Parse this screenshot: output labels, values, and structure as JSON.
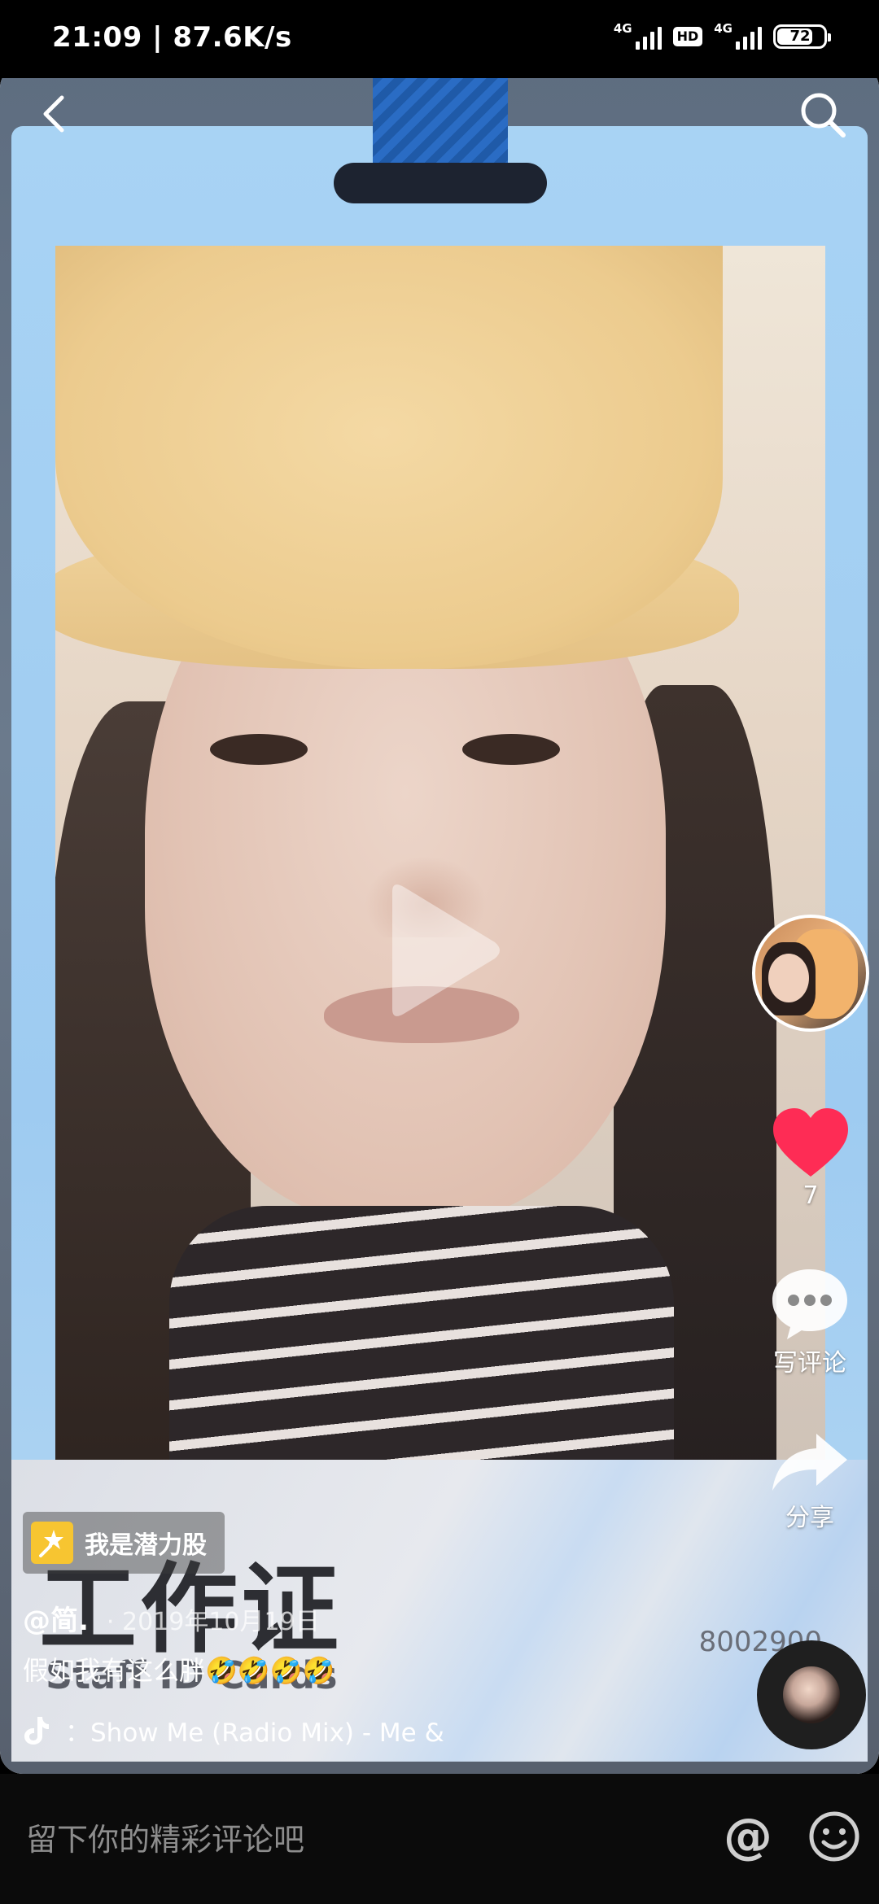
{
  "status_bar": {
    "time_speed": "21:09 | 87.6K/s",
    "network_1": "4G",
    "hd": "HD",
    "network_2": "4G",
    "battery": "72",
    "battery_level": 0.72
  },
  "icons": {
    "back": "back-arrow-icon",
    "search": "search-icon",
    "play": "play-icon",
    "like": "heart-icon",
    "comment": "comment-bubble-icon",
    "share": "share-arrow-icon",
    "music": "tiktok-note-icon",
    "at": "at-icon",
    "emoji": "smiley-icon"
  },
  "video_overlay_text": {
    "card_title": "工作证",
    "card_subtitle": "Staff ID Cards",
    "card_id": "8002900"
  },
  "actions": {
    "like_count": "7",
    "comment_label": "写评论",
    "share_label": "分享"
  },
  "post": {
    "topic": "我是潜力股",
    "author": "@简.",
    "date": "· 2019年10月19日",
    "caption": "假如我有这么胖🤣🤣🤣🤣",
    "music": "：Show Me (Radio Mix) - Me &"
  },
  "comment_bar": {
    "placeholder": "留下你的精彩评论吧",
    "at_symbol": "@"
  },
  "colors": {
    "like_red": "#fe2c55",
    "topic_yellow": "#f7c531",
    "badge_blue": "#a8d3f4"
  }
}
